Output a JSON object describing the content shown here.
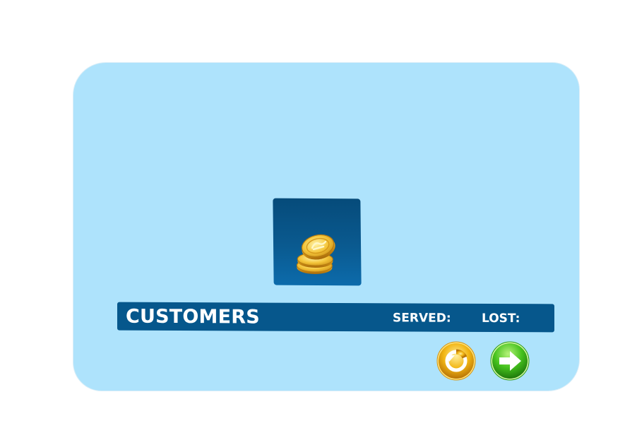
{
  "hud": {
    "title": "CUSTOMERS",
    "served_label": "SERVED:",
    "lost_label": "LOST:"
  },
  "reward": {
    "icon": "gold-coins-icon"
  },
  "buttons": {
    "replay_icon": "replay-icon",
    "next_icon": "next-arrow-icon"
  },
  "colors": {
    "panel": "#aee3fc",
    "bar": "#06578c",
    "coin_gold": "#f2c13a",
    "replay_gold": "#f0b512",
    "next_green": "#3fbf1e"
  }
}
